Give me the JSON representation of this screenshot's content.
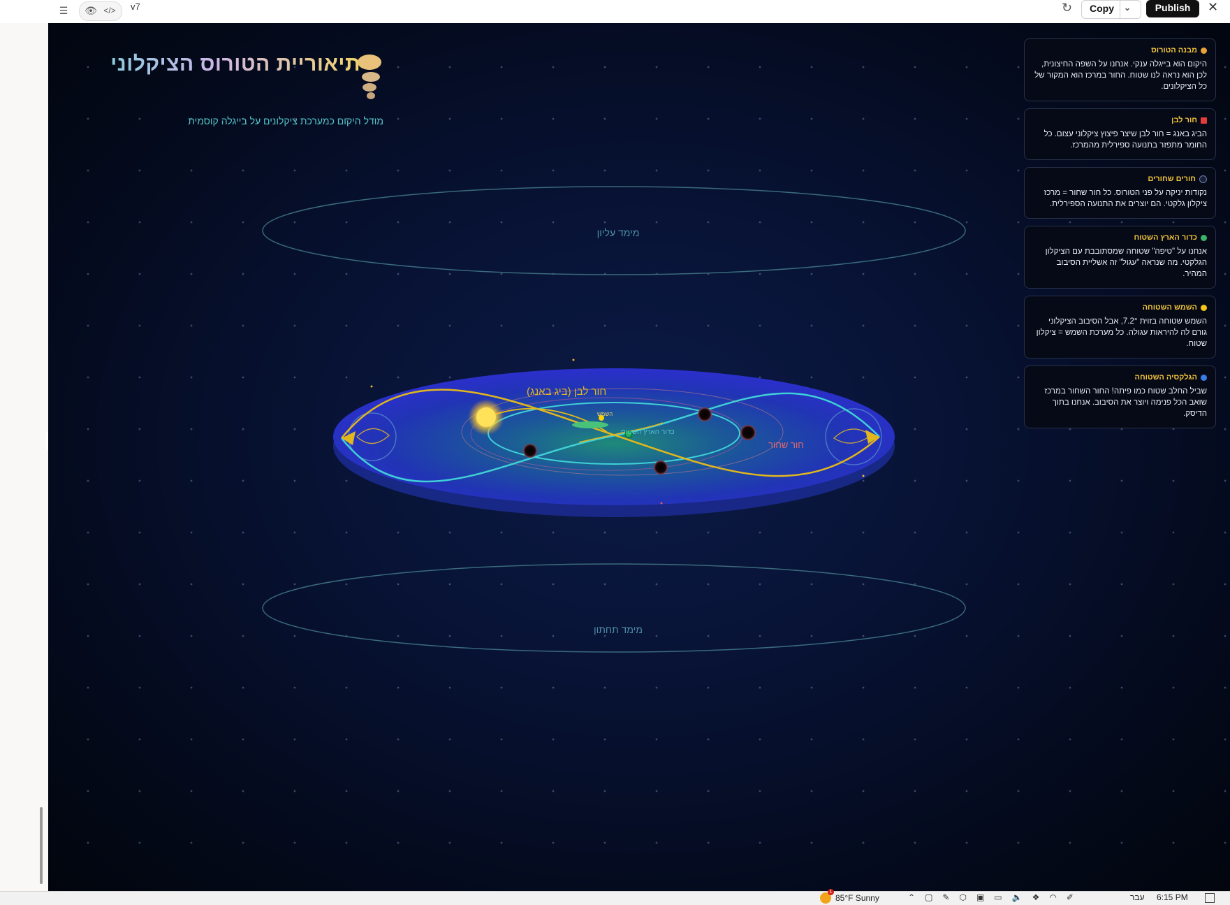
{
  "toolbar": {
    "version": "v7",
    "copy_label": "Copy",
    "publish_label": "Publish"
  },
  "header": {
    "title": "תיאוריית הטורוס הציקלוני",
    "subtitle": "מודל היקום כמערכת ציקלונים על בייגלה קוסמית"
  },
  "scene": {
    "upper_dimension": "מימד עליון",
    "lower_dimension": "מימד תחתון",
    "white_hole": "חור לבן (ביג באנג)",
    "black_hole": "חור שחור",
    "sun": "השמש",
    "flat_earth": "כדור הארץ השטוח"
  },
  "cards": [
    {
      "icon": "bagel-icon",
      "color": "#e9a23b",
      "title": "מבנה הטורוס",
      "text": "היקום הוא בייגלה ענקי. אנחנו על השפה החיצונית, לכן הוא נראה לנו שטוח. החור במרכז הוא המקור של כל הציקלונים."
    },
    {
      "icon": "white-hole-icon",
      "color": "#e63b3b",
      "title": "חור לבן",
      "text": "הביג באנג = חור לבן שיצר פיצוץ ציקלוני עצום. כל החומר מתפזר בתנועה ספירלית מהמרכז."
    },
    {
      "icon": "black-hole-icon",
      "color": "#6b7fb8",
      "title": "חורים שחורים",
      "text": "נקודות יניקה על פני הטורוס. כל חור שחור = מרכז ציקלון גלקטי. הם יוצרים את התנועה הספירלית."
    },
    {
      "icon": "earth-icon",
      "color": "#3bb36b",
      "title": "כדור הארץ השטוח",
      "text": "אנחנו על \"טיפה\" שטוחה שמסתובבת עם הציקלון הגלקטי. מה שנראה \"עגול\" זה אשליית הסיבוב המהיר."
    },
    {
      "icon": "sun-icon",
      "color": "#f5c518",
      "title": "השמש השטוחה",
      "text": "השמש שטוחה בזוית 7.2°, אבל הסיבוב הציקלוני גורם לה להיראות עגולה. כל מערכת השמש = ציקלון שטוח."
    },
    {
      "icon": "galaxy-icon",
      "color": "#3b7be6",
      "title": "הגלקסיה השטוחה",
      "text": "שביל החלב שטוח כמו פיתה! החור השחור במרכז שואב הכל פנימה ויוצר את הסיבוב. אנחנו בתוך הדיסק."
    }
  ],
  "taskbar": {
    "weather": "85°F  Sunny",
    "badge": "1",
    "language": "עבר",
    "time": "6:15 PM"
  }
}
